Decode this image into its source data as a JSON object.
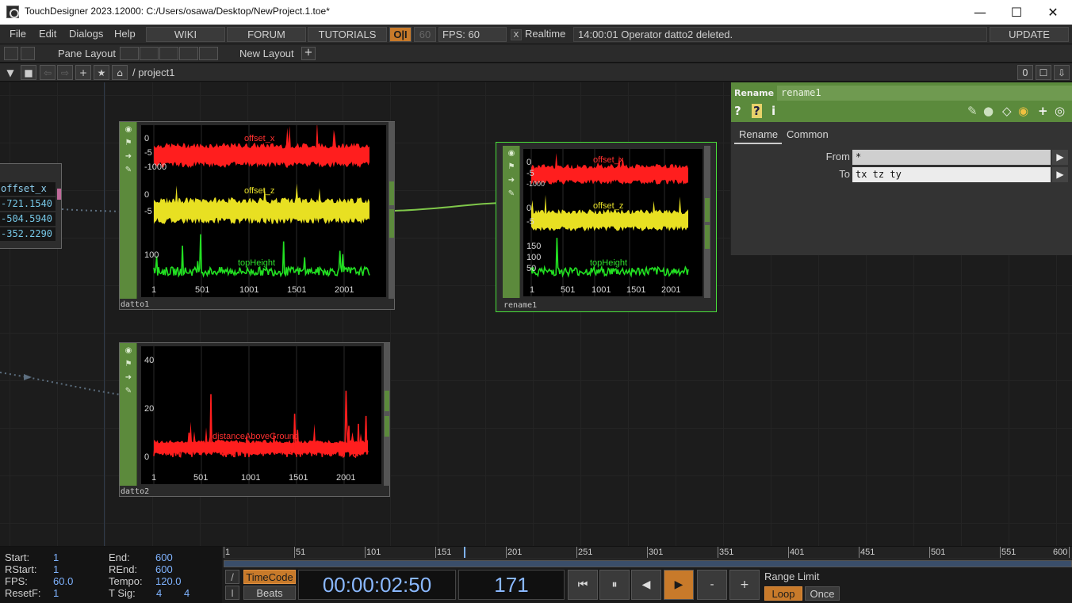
{
  "window": {
    "title": "TouchDesigner 2023.12000: C:/Users/osawa/Desktop/NewProject.1.toe*",
    "minimize": "—",
    "maximize": "☐",
    "close": "✕"
  },
  "menu": {
    "items": [
      "File",
      "Edit",
      "Dialogs",
      "Help"
    ],
    "wiki": "WIKI",
    "forum": "FORUM",
    "tutorials": "TUTORIALS",
    "oi": "O|I",
    "fps_box": "60",
    "fps_label": "FPS:  60",
    "realtime_check": "X",
    "realtime": "Realtime",
    "status": "14:00:01 Operator datto2 deleted.",
    "update": "UPDATE"
  },
  "panebar": {
    "pane_layout": "Pane Layout",
    "new_layout": "New Layout",
    "add": "+"
  },
  "pathbar": {
    "path": "/ project1",
    "counter": "0"
  },
  "nodes": {
    "datto1": {
      "name": "datto1",
      "channels": [
        "offset_x",
        "offset_z",
        "topHeight"
      ],
      "y_labels": [
        [
          "0",
          "-5",
          "-1000"
        ],
        [
          "0",
          "-5"
        ],
        [
          "100"
        ]
      ],
      "x_labels": [
        "1",
        "501",
        "1001",
        "1501",
        "2001"
      ]
    },
    "rename1": {
      "name": "rename1",
      "channels": [
        "offset_x",
        "offset_z",
        "topHeight"
      ],
      "y_labels": [
        [
          "0",
          "-5",
          "-1000"
        ],
        [
          "0",
          "-5"
        ],
        [
          "150",
          "100",
          "50"
        ]
      ],
      "x_labels": [
        "1",
        "501",
        "1001",
        "1501",
        "2001"
      ]
    },
    "datto2": {
      "name": "datto2",
      "channel": "distanceAboveGround",
      "y_labels": [
        "40",
        "20",
        "0"
      ],
      "x_labels": [
        "1",
        "501",
        "1001",
        "1501",
        "2001"
      ]
    },
    "left_table": {
      "header": "offset_x",
      "values": [
        "-721.1540",
        "-504.5940",
        "-352.2290"
      ]
    }
  },
  "params": {
    "op_type": "Rename",
    "op_name": "rename1",
    "icons": [
      "?",
      "?",
      "i",
      "✎",
      "●",
      "◇",
      "◉",
      "+",
      "◎"
    ],
    "tabs": [
      "Rename",
      "Common"
    ],
    "from_label": "From",
    "from_value": "*",
    "to_label": "To",
    "to_value": "tx tz ty",
    "arrow": "▶"
  },
  "timeline": {
    "start_label": "Start:",
    "start": "1",
    "end_label": "End:",
    "end": "600",
    "rstart_label": "RStart:",
    "rstart": "1",
    "rend_label": "REnd:",
    "rend": "600",
    "fps_label": "FPS:",
    "fps": "60.0",
    "tempo_label": "Tempo:",
    "tempo": "120.0",
    "resetf_label": "ResetF:",
    "resetf": "1",
    "tsig_label": "T Sig:",
    "tsig_a": "4",
    "tsig_b": "4",
    "ruler": [
      "1",
      "51",
      "101",
      "151",
      "201",
      "251",
      "301",
      "351",
      "401",
      "451",
      "501",
      "551",
      "600"
    ],
    "current_frame_marker": 171,
    "timecode_btn": "TimeCode",
    "beats_btn": "Beats",
    "timecode": "00:00:02:50",
    "frame": "171",
    "transport": [
      "⏮",
      "⏸",
      "◀",
      "▶",
      "-",
      "+"
    ],
    "range_limit": "Range Limit",
    "loop": "Loop",
    "once": "Once",
    "slash": "/",
    "pipe": "I"
  }
}
